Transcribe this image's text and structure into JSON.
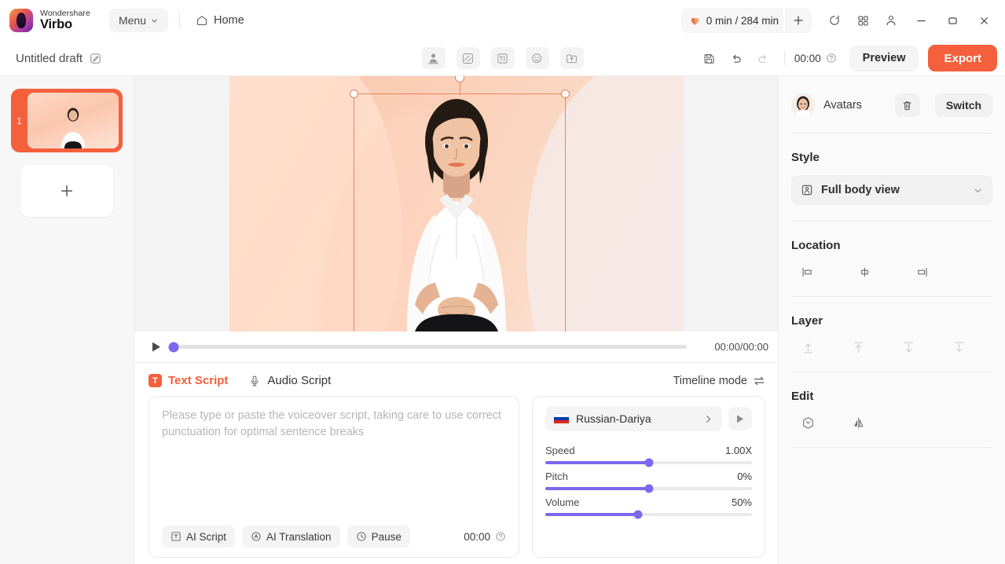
{
  "brand": {
    "top": "Wondershare",
    "bottom": "Virbo",
    "logo_icon": "virbo-logo-icon"
  },
  "titlebar": {
    "menu_label": "Menu",
    "menu_caret_icon": "chevron-down-icon",
    "home_label": "Home",
    "home_icon": "home-icon",
    "credits_label": "0 min / 284 min",
    "credits_icon": "heart-credit-icon",
    "add_credits_icon": "plus-icon",
    "history_icon": "history-icon",
    "apps_icon": "grid-apps-icon",
    "account_icon": "user-account-icon",
    "minimize_icon": "minimize-icon",
    "maximize_icon": "maximize-icon",
    "close_icon": "close-icon"
  },
  "subbar": {
    "doc_title": "Untitled draft",
    "edit_title_icon": "edit-pencil-icon",
    "tools": [
      {
        "name": "avatar-tool",
        "icon": "avatar-person-icon"
      },
      {
        "name": "background-tool",
        "icon": "background-stripes-icon"
      },
      {
        "name": "text-tool",
        "icon": "text-TI-icon"
      },
      {
        "name": "sticker-tool",
        "icon": "sticker-smiley-icon"
      },
      {
        "name": "upload-tool",
        "icon": "upload-folder-icon"
      }
    ],
    "save_icon": "save-disk-icon",
    "undo_icon": "undo-icon",
    "redo_icon": "redo-icon",
    "duration": "00:00",
    "duration_help_icon": "question-circle-icon",
    "preview_label": "Preview",
    "export_label": "Export"
  },
  "scenes": {
    "items": [
      {
        "number": "1"
      }
    ],
    "add_label": "+",
    "add_icon": "plus-icon"
  },
  "canvas": {
    "selection": {
      "rotate_handle_icon": "rotate-handle-icon"
    }
  },
  "player": {
    "play_icon": "play-icon",
    "time": "00:00/00:00",
    "progress_percent": 0
  },
  "script": {
    "tabs": [
      {
        "label": "Text Script",
        "badge": "T",
        "icon": "text-script-icon",
        "active": true
      },
      {
        "label": "Audio Script",
        "icon": "microphone-icon",
        "active": false
      }
    ],
    "timeline_mode_label": "Timeline mode",
    "timeline_mode_icon": "swap-arrows-icon",
    "textarea_value": "",
    "textarea_placeholder": "Please type or paste the voiceover script, taking care to use correct punctuation for optimal sentence breaks",
    "actions": [
      {
        "label": "AI Script",
        "icon": "text-box-icon"
      },
      {
        "label": "AI Translation",
        "icon": "translate-circle-icon"
      },
      {
        "label": "Pause",
        "icon": "clock-pause-icon"
      }
    ],
    "count": "00:00",
    "count_help_icon": "question-circle-icon"
  },
  "voice": {
    "language": "Russian-Dariya",
    "flag_icon": "flag-russia-icon",
    "expand_icon": "chevron-right-icon",
    "preview_icon": "play-icon",
    "sliders": [
      {
        "label": "Speed",
        "value": "1.00X",
        "percent": 50
      },
      {
        "label": "Pitch",
        "value": "0%",
        "percent": 50
      },
      {
        "label": "Volume",
        "value": "50%",
        "percent": 45
      }
    ]
  },
  "right_panel": {
    "header": {
      "title": "Avatars",
      "avatar_icon": "avatar-thumbnail",
      "delete_icon": "trash-icon",
      "switch_label": "Switch"
    },
    "style": {
      "label": "Style",
      "value": "Full body view",
      "value_icon": "person-frame-icon",
      "caret_icon": "chevron-down-icon"
    },
    "location": {
      "label": "Location",
      "icons": [
        {
          "name": "align-left-icon"
        },
        {
          "name": "align-center-icon"
        },
        {
          "name": "align-right-icon"
        }
      ]
    },
    "layer": {
      "label": "Layer",
      "icons": [
        {
          "name": "bring-to-front-icon"
        },
        {
          "name": "bring-forward-icon"
        },
        {
          "name": "send-backward-icon"
        },
        {
          "name": "send-to-back-icon"
        }
      ]
    },
    "edit": {
      "label": "Edit",
      "icons": [
        {
          "name": "crop-shape-icon"
        },
        {
          "name": "flip-horizontal-icon"
        }
      ]
    }
  },
  "colors": {
    "accent": "#f4603c",
    "slider": "#7b68ee",
    "panel_bg": "#fafafa",
    "canvas_bg": "#fbcbb2"
  }
}
